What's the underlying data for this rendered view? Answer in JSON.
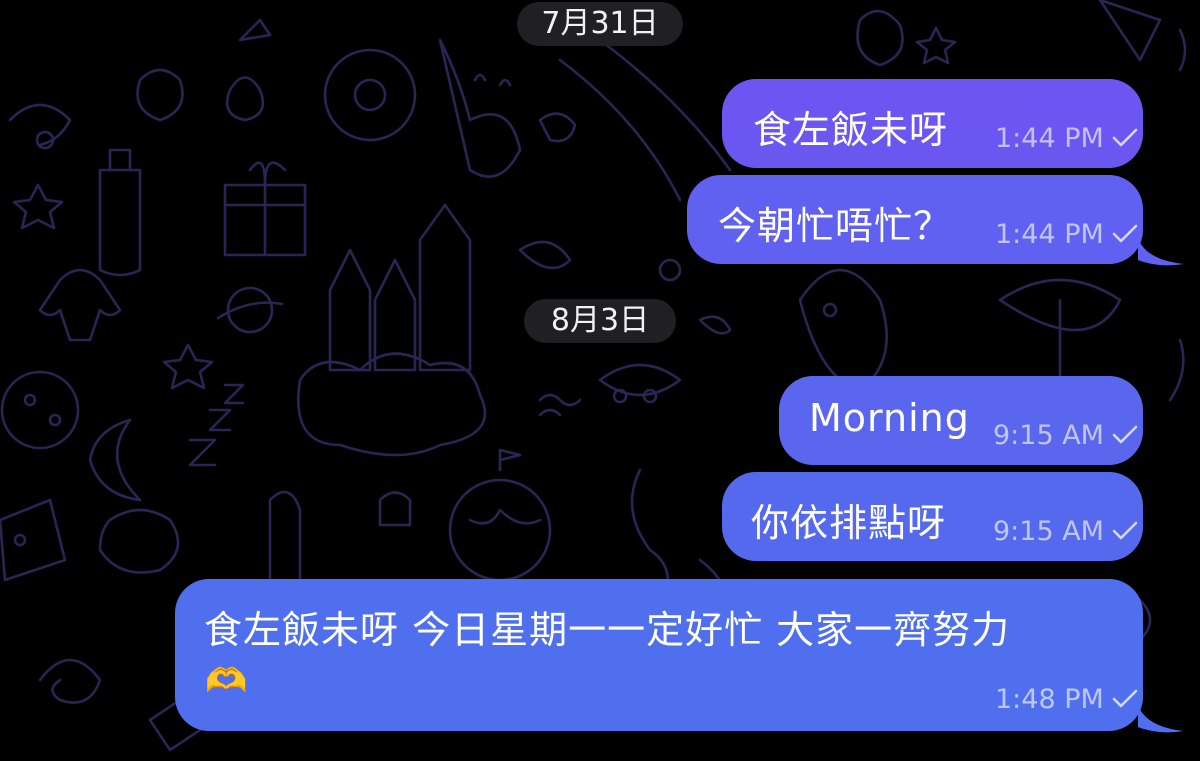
{
  "chat": {
    "date_1": "7月31日",
    "date_2": "8月3日",
    "messages": [
      {
        "text": "食左飯未呀",
        "time": "1:44 PM",
        "status": "sent"
      },
      {
        "text": "今朝忙唔忙？",
        "time": "1:44 PM",
        "status": "sent"
      },
      {
        "text": "Morning",
        "time": "9:15 AM",
        "status": "sent"
      },
      {
        "text": "你依排點呀",
        "time": "9:15 AM",
        "status": "sent"
      },
      {
        "text": "食左飯未呀 今日星期一一定好忙 大家一齊努力",
        "emoji": "🫶",
        "time": "1:48 PM",
        "status": "sent"
      }
    ]
  },
  "theme": {
    "background": "#000000",
    "bubble_top": "#6c55f2",
    "bubble_bottom": "#4f6fee",
    "date_pill": "#1f1f24",
    "doodle_stroke": "#2a2552"
  },
  "icons": {
    "status": "checkmark-icon",
    "wallpaper": "doodle-pattern"
  }
}
